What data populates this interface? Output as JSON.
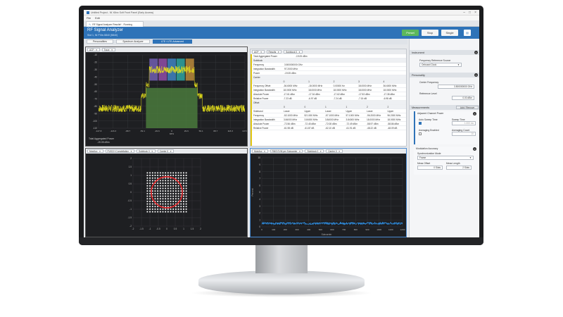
{
  "window": {
    "title": "Untitled Project - NI Xilinx Soft Front Panel (Early Access)",
    "menu": [
      "File",
      "Edit"
    ],
    "doc_tab": "RF Signal Analyzer Results* - Running"
  },
  "header": {
    "title": "RF Signal Analyzer",
    "subtitle": "Slot 1, NI PXIe-5840 (5840)",
    "buttons": {
      "preset": "Preset",
      "stop": "Stop",
      "single": "Single"
    }
  },
  "subtabs": [
    "Personalities",
    "Spectrum Analyzer",
    "LTE / LTE-Advanced"
  ],
  "spectrum_panel": {
    "dropdowns": [
      "ACP",
      "Trace"
    ],
    "y_ticks": [
      "-10",
      "-20",
      "-30",
      "-40",
      "-50",
      "-60",
      "-70",
      "-80",
      "-90",
      "-100",
      "-110"
    ],
    "x_ticks": [
      "-147.8",
      "-118.3",
      "-88.7",
      "-59.1",
      "-29.6",
      "0",
      "29.6",
      "59.1",
      "88.7",
      "118.3",
      "147.8"
    ],
    "x_label": "MHz",
    "footer_label": "Total Aggregated Power",
    "footer_value": "-19.05 dBm"
  },
  "results_panel": {
    "dropdowns": [
      "ACP",
      "Results",
      "Subblock 0"
    ],
    "total_power_label": "Total Aggregated Power",
    "total_power_value": "-19.05 dBm",
    "subblock_label": "Subblock",
    "subblock_rows": [
      {
        "label": "Frequency",
        "value": "3.500000000 GHz"
      },
      {
        "label": "Integration Bandwidth",
        "value": "97.2000 MHz"
      },
      {
        "label": "Power",
        "value": "-19.05 dBm"
      }
    ],
    "carrier_label": "Carrier",
    "carrier_cols": [
      "0",
      "1",
      "2",
      "3",
      "4"
    ],
    "carrier_rows": [
      {
        "label": "Frequency Offset",
        "cells": [
          "-36.6000 MHz",
          "-18.0000 MHz",
          "0.00000 Hz",
          "18.0000 MHz",
          "36.6000 MHz"
        ]
      },
      {
        "label": "Integration Bandwidth",
        "cells": [
          "18.0000 MHz",
          "18.0000 MHz",
          "18.0000 MHz",
          "18.0000 MHz",
          "18.0000 MHz"
        ]
      },
      {
        "label": "Absolute Power",
        "cells": [
          "-17.61 dBm",
          "-17.34 dBm",
          "-17.62 dBm",
          "-17.53 dBm",
          "-17.38 dBm"
        ]
      },
      {
        "label": "Relative Power",
        "cells": [
          "-7.23 dB",
          "-6.97 dB",
          "-7.24 dB",
          "-7.15 dB",
          "-6.98 dB"
        ]
      }
    ],
    "offset_label": "Offset",
    "offset_cols": [
      "0",
      "0",
      "1",
      "1",
      "2",
      "2"
    ],
    "offset_rows": [
      {
        "label": "Sideband",
        "cells": [
          "Lower",
          "Upper",
          "Lower",
          "Upper",
          "Lower",
          "Upper"
        ]
      },
      {
        "label": "Frequency",
        "cells": [
          "-52.1000 MHz",
          "52.1000 MHz",
          "-57.1000 MHz",
          "57.1000 MHz",
          "-96.2000 MHz",
          "96.2000 MHz"
        ]
      },
      {
        "label": "Integration Bandwidth",
        "cells": [
          "3.84000 MHz",
          "3.84000 MHz",
          "3.84000 MHz",
          "3.84000 MHz",
          "18.0000 MHz",
          "18.0000 MHz"
        ]
      },
      {
        "label": "Absolute Power",
        "cells": [
          "-72.56 dBm",
          "-72.45 dBm",
          "-72.08 dBm",
          "-72.49 dBm",
          "-58.97 dBm",
          "-58.86 dBm"
        ]
      },
      {
        "label": "Relative Power",
        "cells": [
          "-61.98 dB",
          "-61.87 dB",
          "-62.10 dB",
          "-61.91 dB",
          "-48.22 dB",
          "-48.09 dB"
        ]
      }
    ]
  },
  "constellation_panel": {
    "dropdowns": [
      "ModAcc",
      "PUSCH Constellation",
      "Subblock 0",
      "Carrier 0"
    ],
    "ticks": [
      "2",
      "1.5",
      "1",
      "0.5",
      "0",
      "-0.5",
      "-1",
      "-1.5",
      "-2"
    ],
    "x_ticks": [
      "-2",
      "-1.5",
      "-1",
      "-0.5",
      "0",
      "0.5",
      "1",
      "1.5",
      "2"
    ]
  },
  "evm_panel": {
    "dropdowns": [
      "ModAcc",
      "RMS EVM per Subcarrier",
      "Subblock 0",
      "Carrier 0"
    ],
    "y_ticks": [
      "10",
      "9",
      "8",
      "7",
      "6",
      "5",
      "4",
      "3",
      "2",
      "1",
      "0"
    ],
    "x_ticks": [
      "0",
      "100",
      "200",
      "300",
      "400",
      "500",
      "600",
      "700",
      "800",
      "900",
      "1000",
      "1100",
      "1200"
    ],
    "x_label": "Subcarrier",
    "y_label": "Percent"
  },
  "sidebar": {
    "instrument": {
      "title": "Instrument",
      "ref_label": "Frequency Reference Source",
      "ref_value": "Onboard Clock"
    },
    "personality": {
      "title": "Personality",
      "cf_label": "Center Frequency",
      "cf_value": "3.500000000 GHz",
      "rl_label": "Reference Level",
      "rl_value": "0.00 dBm"
    },
    "measurements": {
      "title": "Measurements",
      "add_remove": "Add / Remove",
      "acp_title": "Adjacent Channel Power",
      "auto_sweep_label": "Auto Sweep Time",
      "sweep_time_label": "Sweep Time",
      "sweep_time_value": "1.000 ms",
      "averaging_enabled_label": "Averaging Enabled",
      "averaging_count_label": "Averaging Count",
      "averaging_count_value": "10",
      "modacc_title": "Modulation Accuracy",
      "sync_mode_label": "Synchronization Mode",
      "sync_mode_value": "Frame",
      "meas_offset_label": "Meas Offset",
      "meas_offset_value": "0 Slots",
      "meas_length_label": "Meas Length",
      "meas_length_value": "2 Slots"
    }
  },
  "colors": {
    "accent_blue": "#2e73b8",
    "spectrum_yellow": "#e6e01a",
    "highlight_green": "#4a7a3c",
    "constellation_ring": "#e3262a",
    "evm_trace": "#2e8de0",
    "panel_border_yellow": "#e2c812"
  }
}
